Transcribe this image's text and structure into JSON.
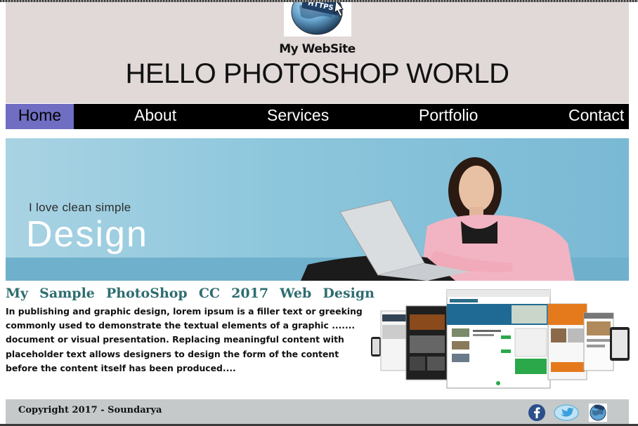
{
  "header": {
    "site_name": "My WebSite",
    "title": "HELLO PHOTOSHOP WORLD",
    "logo_text": "HTTPS"
  },
  "nav": {
    "items": [
      {
        "label": "Home",
        "active": true
      },
      {
        "label": "About",
        "active": false
      },
      {
        "label": "Services",
        "active": false
      },
      {
        "label": "Portfolio",
        "active": false
      },
      {
        "label": "Contact",
        "active": false
      }
    ]
  },
  "hero": {
    "small_text": "I love clean simple",
    "big_text": "Design"
  },
  "content": {
    "title_words": [
      "My",
      "Sample",
      "PhotoShop",
      "CC",
      "2017",
      "Web",
      "Design"
    ],
    "paragraph": "In publishing and graphic design, lorem ipsum is a filler text or greeking commonly used to demonstrate the textual elements of a graphic ....... document or visual presentation. Replacing meaningful content with placeholder text allows designers to design the form of the content before the content itself has been produced...."
  },
  "footer": {
    "copyright": "Copyright 2017  - Soundarya",
    "social_icons": [
      "facebook-icon",
      "twitter-icon",
      "web-globe-icon"
    ]
  },
  "colors": {
    "header_bg": "#e1d9d8",
    "nav_bg": "#000000",
    "nav_active_bg": "#6f6ec2",
    "title_color": "#2f6d70",
    "footer_bg": "#c5c9c9"
  }
}
